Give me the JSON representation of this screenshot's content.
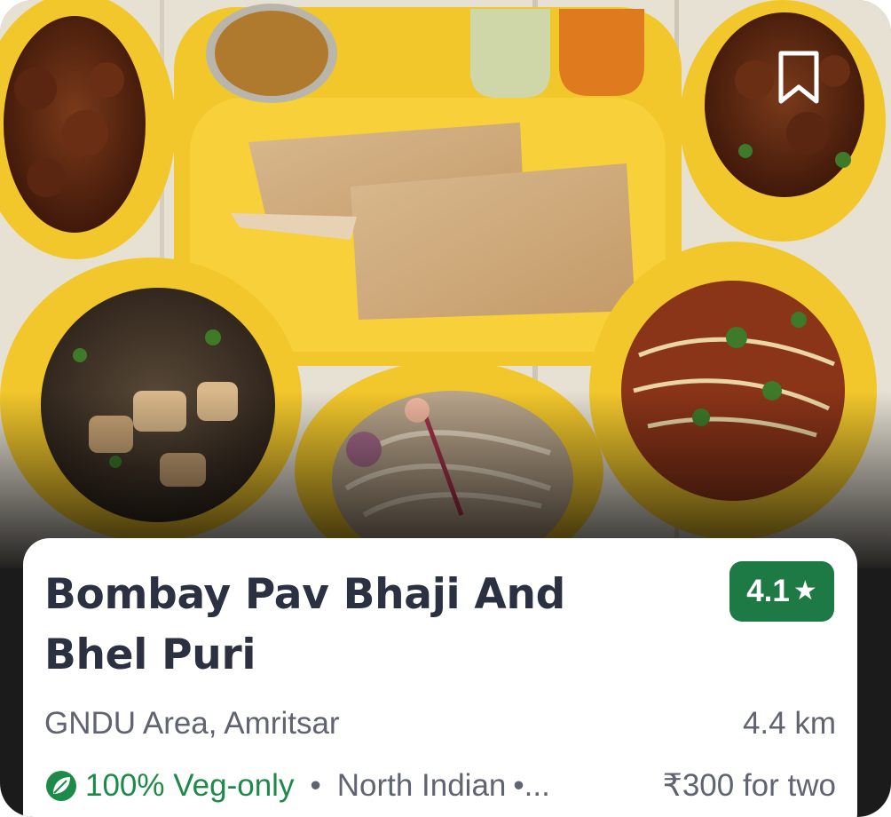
{
  "restaurant": {
    "name": "Bombay Pav Bhaji And Bhel Puri",
    "rating": "4.1",
    "rating_icon": "star-icon",
    "location": "GNDU Area, Amritsar",
    "distance": "4.4 km",
    "veg_label": "100% Veg-only",
    "separator": "•",
    "cuisine": "North Indian",
    "cuisine_more": "•...",
    "price": "₹300 for two"
  },
  "icons": {
    "bookmark": "bookmark-icon",
    "leaf": "leaf-icon"
  },
  "colors": {
    "rating_bg": "#1e7a44",
    "veg_text": "#1e8a4a",
    "title_text": "#2b3140",
    "plate_yellow": "#f2c72c"
  }
}
